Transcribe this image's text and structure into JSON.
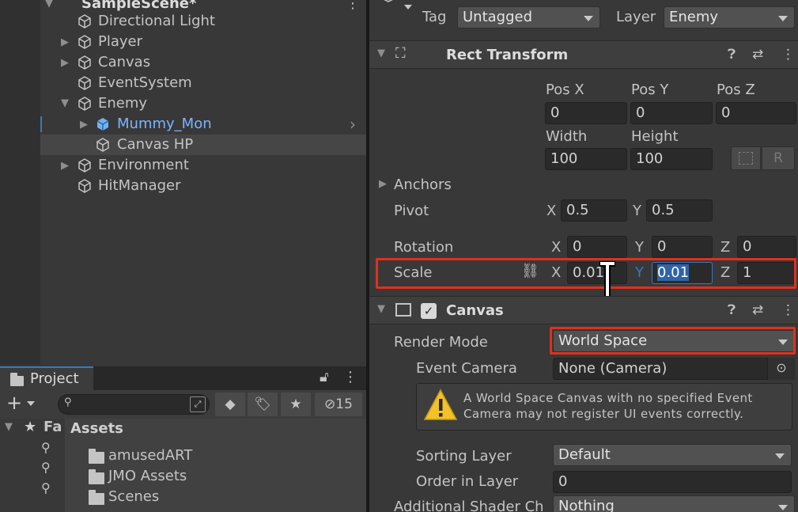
{
  "hierarchy": {
    "scene_label": "SampleScene*",
    "items": [
      {
        "label": "Directional Light"
      },
      {
        "label": "Player"
      },
      {
        "label": "Canvas"
      },
      {
        "label": "EventSystem"
      },
      {
        "label": "Enemy"
      },
      {
        "label": "Mummy_Mon"
      },
      {
        "label": "Canvas HP"
      },
      {
        "label": "Environment"
      },
      {
        "label": "HitManager"
      }
    ]
  },
  "inspector": {
    "tag_label": "Tag",
    "tag_value": "Untagged",
    "layer_label": "Layer",
    "layer_value": "Enemy",
    "rect_transform": {
      "title": "Rect Transform",
      "pos_x_label": "Pos X",
      "pos_y_label": "Pos Y",
      "pos_z_label": "Pos Z",
      "pos_x": "0",
      "pos_y": "0",
      "pos_z": "0",
      "width_label": "Width",
      "height_label": "Height",
      "width": "100",
      "height": "100",
      "r_button": "R",
      "anchors_label": "Anchors",
      "pivot_label": "Pivot",
      "pivot_x": "0.5",
      "pivot_y": "0.5",
      "rotation_label": "Rotation",
      "rotation_x": "0",
      "rotation_y": "0",
      "rotation_z": "0",
      "scale_label": "Scale",
      "scale_x": "0.01",
      "scale_y": "0.01",
      "scale_z": "1",
      "axis_x": "X",
      "axis_y": "Y",
      "axis_z": "Z"
    },
    "canvas": {
      "title": "Canvas",
      "render_mode_label": "Render Mode",
      "render_mode_value": "World Space",
      "event_camera_label": "Event Camera",
      "event_camera_value": "None (Camera)",
      "warning_text_line1": "A World Space Canvas with no specified Event",
      "warning_text_line2": "Camera may not register UI events correctly.",
      "sorting_layer_label": "Sorting Layer",
      "sorting_layer_value": "Default",
      "order_in_layer_label": "Order in Layer",
      "order_in_layer_value": "0",
      "additional_shader_label": "Additional Shader Ch",
      "additional_shader_value": "Nothing"
    }
  },
  "project": {
    "tab_label": "Project",
    "favorites_label": "Fa",
    "assets_label": "Assets",
    "hidden_count": "15",
    "folders": [
      {
        "label": "amusedART"
      },
      {
        "label": "JMO Assets"
      },
      {
        "label": "Scenes"
      }
    ]
  },
  "colors": {
    "highlight": "#e0301e",
    "selection_text": "#7cb4ff",
    "accent": "#3a79bb"
  }
}
